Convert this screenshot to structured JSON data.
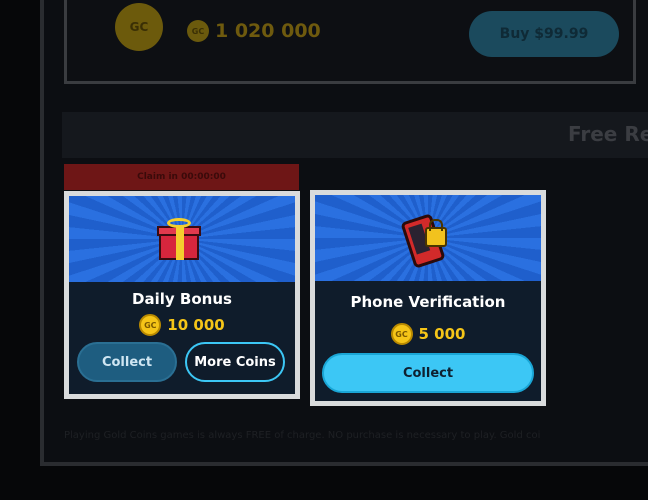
{
  "package": {
    "coin_label": "GC",
    "amount": "1 020 000",
    "buy_label": "Buy $99.99"
  },
  "free_section": {
    "title": "Free Re"
  },
  "daily_bonus": {
    "timer_text": "Claim in 00:00:00",
    "title": "Daily Bonus",
    "coin_label": "GC",
    "amount": "10 000",
    "collect_label": "Collect",
    "more_label": "More Coins"
  },
  "phone_verification": {
    "title": "Phone Verification",
    "coin_label": "GC",
    "amount": "5 000",
    "collect_label": "Collect"
  },
  "footnote": "Playing Gold Coins games is always FREE of charge. NO purchase is necessary to play. Gold coi",
  "colors": {
    "accent": "#3cc7f5",
    "coin": "#f5c518",
    "banner": "#2a70e0"
  }
}
